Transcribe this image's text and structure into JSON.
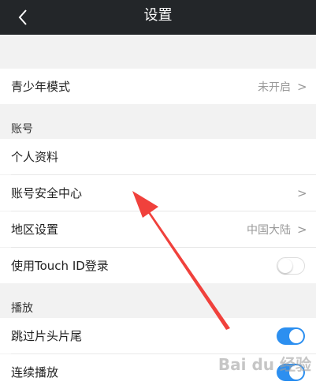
{
  "header": {
    "title": "设置",
    "back_icon": "chevron-left-icon"
  },
  "rows": {
    "youth_mode": {
      "label": "青少年模式",
      "value": "未开启"
    },
    "profile": {
      "label": "个人资料"
    },
    "security": {
      "label": "账号安全中心"
    },
    "region": {
      "label": "地区设置",
      "value": "中国大陆"
    },
    "touch_id": {
      "label": "使用Touch ID登录",
      "toggle": "off"
    },
    "skip_intro": {
      "label": "跳过片头片尾",
      "toggle": "on"
    },
    "autoplay": {
      "label": "连续播放",
      "toggle": "on"
    }
  },
  "sections": {
    "account": "账号",
    "playback": "播放"
  },
  "chevron": ">",
  "watermark": "Bai du 经验",
  "colors": {
    "header_bg": "#232629",
    "toggle_on": "#2c8ff0",
    "arrow": "#f0413c"
  }
}
